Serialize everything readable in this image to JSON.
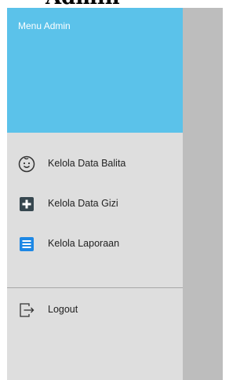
{
  "page": {
    "header_text": "Admin"
  },
  "drawer": {
    "title": "Menu Admin",
    "items": [
      {
        "label": "Kelola Data Balita",
        "icon": "baby-face-icon"
      },
      {
        "label": "Kelola Data Gizi",
        "icon": "plus-box-icon"
      },
      {
        "label": "Kelola Laporaan",
        "icon": "list-document-icon"
      }
    ],
    "logout": {
      "label": "Logout",
      "icon": "logout-icon"
    }
  },
  "colors": {
    "header": "#5bc2ea",
    "drawer_bg": "#dedede",
    "scrim": "#bdbdbd",
    "plus_icon": "#37474f",
    "list_icon": "#1e88e5"
  }
}
